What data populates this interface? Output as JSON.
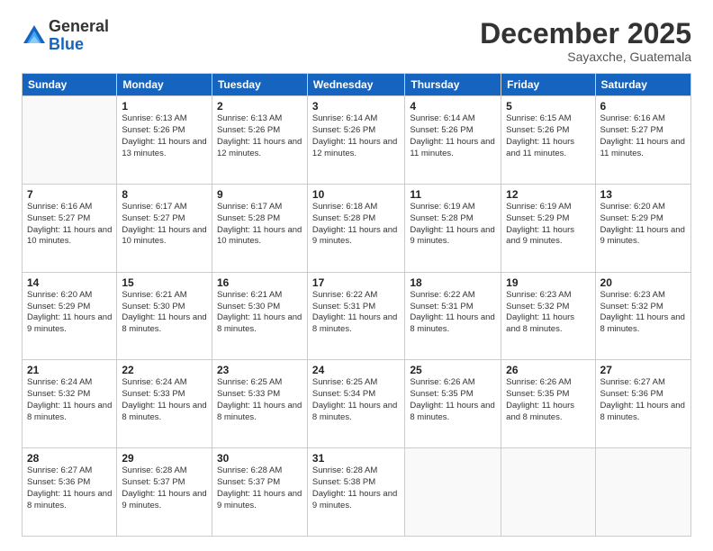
{
  "logo": {
    "general": "General",
    "blue": "Blue"
  },
  "header": {
    "month": "December 2025",
    "location": "Sayaxche, Guatemala"
  },
  "weekdays": [
    "Sunday",
    "Monday",
    "Tuesday",
    "Wednesday",
    "Thursday",
    "Friday",
    "Saturday"
  ],
  "weeks": [
    [
      {
        "day": "",
        "sunrise": "",
        "sunset": "",
        "daylight": ""
      },
      {
        "day": "1",
        "sunrise": "Sunrise: 6:13 AM",
        "sunset": "Sunset: 5:26 PM",
        "daylight": "Daylight: 11 hours and 13 minutes."
      },
      {
        "day": "2",
        "sunrise": "Sunrise: 6:13 AM",
        "sunset": "Sunset: 5:26 PM",
        "daylight": "Daylight: 11 hours and 12 minutes."
      },
      {
        "day": "3",
        "sunrise": "Sunrise: 6:14 AM",
        "sunset": "Sunset: 5:26 PM",
        "daylight": "Daylight: 11 hours and 12 minutes."
      },
      {
        "day": "4",
        "sunrise": "Sunrise: 6:14 AM",
        "sunset": "Sunset: 5:26 PM",
        "daylight": "Daylight: 11 hours and 11 minutes."
      },
      {
        "day": "5",
        "sunrise": "Sunrise: 6:15 AM",
        "sunset": "Sunset: 5:26 PM",
        "daylight": "Daylight: 11 hours and 11 minutes."
      },
      {
        "day": "6",
        "sunrise": "Sunrise: 6:16 AM",
        "sunset": "Sunset: 5:27 PM",
        "daylight": "Daylight: 11 hours and 11 minutes."
      }
    ],
    [
      {
        "day": "7",
        "sunrise": "Sunrise: 6:16 AM",
        "sunset": "Sunset: 5:27 PM",
        "daylight": "Daylight: 11 hours and 10 minutes."
      },
      {
        "day": "8",
        "sunrise": "Sunrise: 6:17 AM",
        "sunset": "Sunset: 5:27 PM",
        "daylight": "Daylight: 11 hours and 10 minutes."
      },
      {
        "day": "9",
        "sunrise": "Sunrise: 6:17 AM",
        "sunset": "Sunset: 5:28 PM",
        "daylight": "Daylight: 11 hours and 10 minutes."
      },
      {
        "day": "10",
        "sunrise": "Sunrise: 6:18 AM",
        "sunset": "Sunset: 5:28 PM",
        "daylight": "Daylight: 11 hours and 9 minutes."
      },
      {
        "day": "11",
        "sunrise": "Sunrise: 6:19 AM",
        "sunset": "Sunset: 5:28 PM",
        "daylight": "Daylight: 11 hours and 9 minutes."
      },
      {
        "day": "12",
        "sunrise": "Sunrise: 6:19 AM",
        "sunset": "Sunset: 5:29 PM",
        "daylight": "Daylight: 11 hours and 9 minutes."
      },
      {
        "day": "13",
        "sunrise": "Sunrise: 6:20 AM",
        "sunset": "Sunset: 5:29 PM",
        "daylight": "Daylight: 11 hours and 9 minutes."
      }
    ],
    [
      {
        "day": "14",
        "sunrise": "Sunrise: 6:20 AM",
        "sunset": "Sunset: 5:29 PM",
        "daylight": "Daylight: 11 hours and 9 minutes."
      },
      {
        "day": "15",
        "sunrise": "Sunrise: 6:21 AM",
        "sunset": "Sunset: 5:30 PM",
        "daylight": "Daylight: 11 hours and 8 minutes."
      },
      {
        "day": "16",
        "sunrise": "Sunrise: 6:21 AM",
        "sunset": "Sunset: 5:30 PM",
        "daylight": "Daylight: 11 hours and 8 minutes."
      },
      {
        "day": "17",
        "sunrise": "Sunrise: 6:22 AM",
        "sunset": "Sunset: 5:31 PM",
        "daylight": "Daylight: 11 hours and 8 minutes."
      },
      {
        "day": "18",
        "sunrise": "Sunrise: 6:22 AM",
        "sunset": "Sunset: 5:31 PM",
        "daylight": "Daylight: 11 hours and 8 minutes."
      },
      {
        "day": "19",
        "sunrise": "Sunrise: 6:23 AM",
        "sunset": "Sunset: 5:32 PM",
        "daylight": "Daylight: 11 hours and 8 minutes."
      },
      {
        "day": "20",
        "sunrise": "Sunrise: 6:23 AM",
        "sunset": "Sunset: 5:32 PM",
        "daylight": "Daylight: 11 hours and 8 minutes."
      }
    ],
    [
      {
        "day": "21",
        "sunrise": "Sunrise: 6:24 AM",
        "sunset": "Sunset: 5:32 PM",
        "daylight": "Daylight: 11 hours and 8 minutes."
      },
      {
        "day": "22",
        "sunrise": "Sunrise: 6:24 AM",
        "sunset": "Sunset: 5:33 PM",
        "daylight": "Daylight: 11 hours and 8 minutes."
      },
      {
        "day": "23",
        "sunrise": "Sunrise: 6:25 AM",
        "sunset": "Sunset: 5:33 PM",
        "daylight": "Daylight: 11 hours and 8 minutes."
      },
      {
        "day": "24",
        "sunrise": "Sunrise: 6:25 AM",
        "sunset": "Sunset: 5:34 PM",
        "daylight": "Daylight: 11 hours and 8 minutes."
      },
      {
        "day": "25",
        "sunrise": "Sunrise: 6:26 AM",
        "sunset": "Sunset: 5:35 PM",
        "daylight": "Daylight: 11 hours and 8 minutes."
      },
      {
        "day": "26",
        "sunrise": "Sunrise: 6:26 AM",
        "sunset": "Sunset: 5:35 PM",
        "daylight": "Daylight: 11 hours and 8 minutes."
      },
      {
        "day": "27",
        "sunrise": "Sunrise: 6:27 AM",
        "sunset": "Sunset: 5:36 PM",
        "daylight": "Daylight: 11 hours and 8 minutes."
      }
    ],
    [
      {
        "day": "28",
        "sunrise": "Sunrise: 6:27 AM",
        "sunset": "Sunset: 5:36 PM",
        "daylight": "Daylight: 11 hours and 8 minutes."
      },
      {
        "day": "29",
        "sunrise": "Sunrise: 6:28 AM",
        "sunset": "Sunset: 5:37 PM",
        "daylight": "Daylight: 11 hours and 9 minutes."
      },
      {
        "day": "30",
        "sunrise": "Sunrise: 6:28 AM",
        "sunset": "Sunset: 5:37 PM",
        "daylight": "Daylight: 11 hours and 9 minutes."
      },
      {
        "day": "31",
        "sunrise": "Sunrise: 6:28 AM",
        "sunset": "Sunset: 5:38 PM",
        "daylight": "Daylight: 11 hours and 9 minutes."
      },
      {
        "day": "",
        "sunrise": "",
        "sunset": "",
        "daylight": ""
      },
      {
        "day": "",
        "sunrise": "",
        "sunset": "",
        "daylight": ""
      },
      {
        "day": "",
        "sunrise": "",
        "sunset": "",
        "daylight": ""
      }
    ]
  ]
}
